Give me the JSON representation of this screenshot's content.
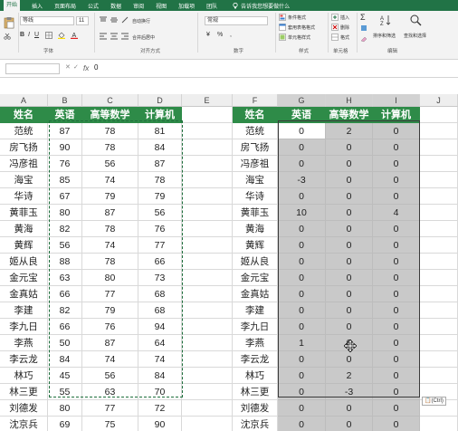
{
  "ribbon": {
    "tabs": [
      "开始",
      "插入",
      "页面布局",
      "公式",
      "数据",
      "审阅",
      "视图",
      "加载项",
      "团队"
    ],
    "search_placeholder": "告诉我您想要做什么",
    "font_name": "等线",
    "font_size": "11",
    "number_format": "常规",
    "wrap_label": "自动换行",
    "merge_label": "合并后居中",
    "conditional_format": "条件格式",
    "table_format": "套用表格格式",
    "cell_styles": "单元格样式",
    "insert_label": "插入",
    "delete_label": "删除",
    "format_label": "格式",
    "sort_filter": "排序和筛选",
    "find_select": "查找和选择",
    "groups": [
      "字体",
      "对齐方式",
      "数字",
      "样式",
      "单元格",
      "编辑"
    ]
  },
  "formula_bar": {
    "fx": "fx",
    "value": "0"
  },
  "columns": [
    "A",
    "B",
    "C",
    "D",
    "E",
    "F",
    "G",
    "H",
    "I",
    "J"
  ],
  "left_table": {
    "headers": [
      "姓名",
      "英语",
      "高等数学",
      "计算机"
    ],
    "rows": [
      [
        "范统",
        "87",
        "78",
        "81"
      ],
      [
        "房飞扬",
        "90",
        "78",
        "84"
      ],
      [
        "冯彦祖",
        "76",
        "56",
        "87"
      ],
      [
        "海宝",
        "85",
        "74",
        "78"
      ],
      [
        "华诗",
        "67",
        "79",
        "79"
      ],
      [
        "黄菲玉",
        "80",
        "87",
        "56"
      ],
      [
        "黄海",
        "82",
        "78",
        "76"
      ],
      [
        "黄辉",
        "56",
        "74",
        "77"
      ],
      [
        "姬从良",
        "88",
        "78",
        "66"
      ],
      [
        "金元宝",
        "63",
        "80",
        "73"
      ],
      [
        "金真姑",
        "66",
        "77",
        "68"
      ],
      [
        "李建",
        "82",
        "79",
        "68"
      ],
      [
        "李九日",
        "66",
        "76",
        "94"
      ],
      [
        "李燕",
        "50",
        "87",
        "64"
      ],
      [
        "李云龙",
        "84",
        "74",
        "74"
      ],
      [
        "林巧",
        "45",
        "56",
        "84"
      ],
      [
        "林三更",
        "55",
        "63",
        "70"
      ],
      [
        "刘德发",
        "80",
        "77",
        "72"
      ],
      [
        "沈京兵",
        "69",
        "75",
        "90"
      ]
    ]
  },
  "right_table": {
    "headers": [
      "姓名",
      "英语",
      "高等数学",
      "计算机"
    ],
    "rows": [
      [
        "范统",
        "0",
        "2",
        "0"
      ],
      [
        "房飞扬",
        "0",
        "0",
        "0"
      ],
      [
        "冯彦祖",
        "0",
        "0",
        "0"
      ],
      [
        "海宝",
        "-3",
        "0",
        "0"
      ],
      [
        "华诗",
        "0",
        "0",
        "0"
      ],
      [
        "黄菲玉",
        "10",
        "0",
        "4"
      ],
      [
        "黄海",
        "0",
        "0",
        "0"
      ],
      [
        "黄辉",
        "0",
        "0",
        "0"
      ],
      [
        "姬从良",
        "0",
        "0",
        "0"
      ],
      [
        "金元宝",
        "0",
        "0",
        "0"
      ],
      [
        "金真姑",
        "0",
        "0",
        "0"
      ],
      [
        "李建",
        "0",
        "0",
        "0"
      ],
      [
        "李九日",
        "0",
        "0",
        "0"
      ],
      [
        "李燕",
        "1",
        "0",
        "0"
      ],
      [
        "李云龙",
        "0",
        "0",
        "0"
      ],
      [
        "林巧",
        "0",
        "2",
        "0"
      ],
      [
        "林三更",
        "0",
        "-3",
        "0"
      ],
      [
        "刘德发",
        "0",
        "0",
        "0"
      ],
      [
        "沈京兵",
        "0",
        "0",
        "0"
      ]
    ]
  },
  "paste_options_label": "(Ctrl)",
  "colors": {
    "accent": "#217346",
    "header_fill": "#2e8b48",
    "selection": "#c9c9c9"
  }
}
